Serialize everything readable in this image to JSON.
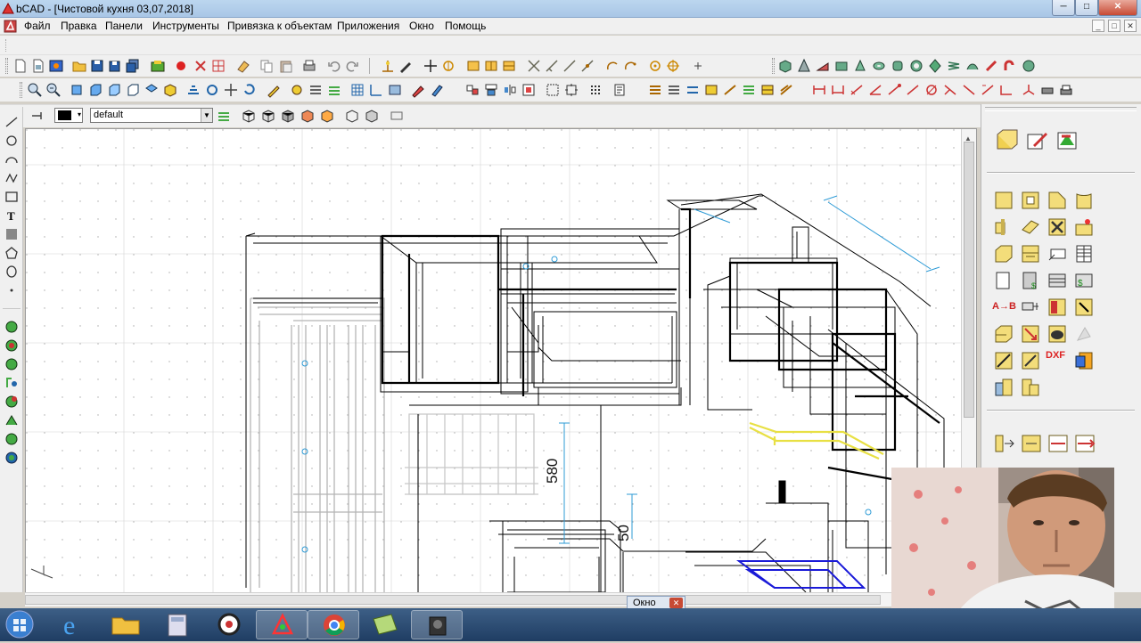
{
  "window": {
    "title": "bCAD - [Чистовой кухня 03,07,2018]",
    "min_glyph": "─",
    "max_glyph": "□",
    "close_glyph": "✕"
  },
  "menu": {
    "items": [
      "Файл",
      "Правка",
      "Панели",
      "Инструменты",
      "Привязка к объектам",
      "Приложения",
      "Окно",
      "Помощь"
    ]
  },
  "mdi_buttons": {
    "min": "_",
    "max": "□",
    "close": "✕"
  },
  "property_bar": {
    "layer": "default",
    "color": "#000000"
  },
  "drawing": {
    "dimension_580": "580",
    "dimension_50": "50"
  },
  "right_panel": {
    "dxf_label": "DXF",
    "ab_label": "A→B"
  },
  "window_tab": {
    "label": "Окно",
    "close_glyph": "✕"
  },
  "taskbar": {
    "items": [
      "start",
      "internet-explorer",
      "file-explorer",
      "calculator",
      "screen-recorder",
      "bcad",
      "chrome",
      "notes",
      "camera"
    ],
    "active": "bcad"
  },
  "colors": {
    "accent_yellow": "#ffff33",
    "dimension_blue": "#2e9bd6",
    "highlight_yellow": "#e8e044",
    "selection_blue": "#1a1ad8",
    "taskbar": "#2a4a73"
  }
}
